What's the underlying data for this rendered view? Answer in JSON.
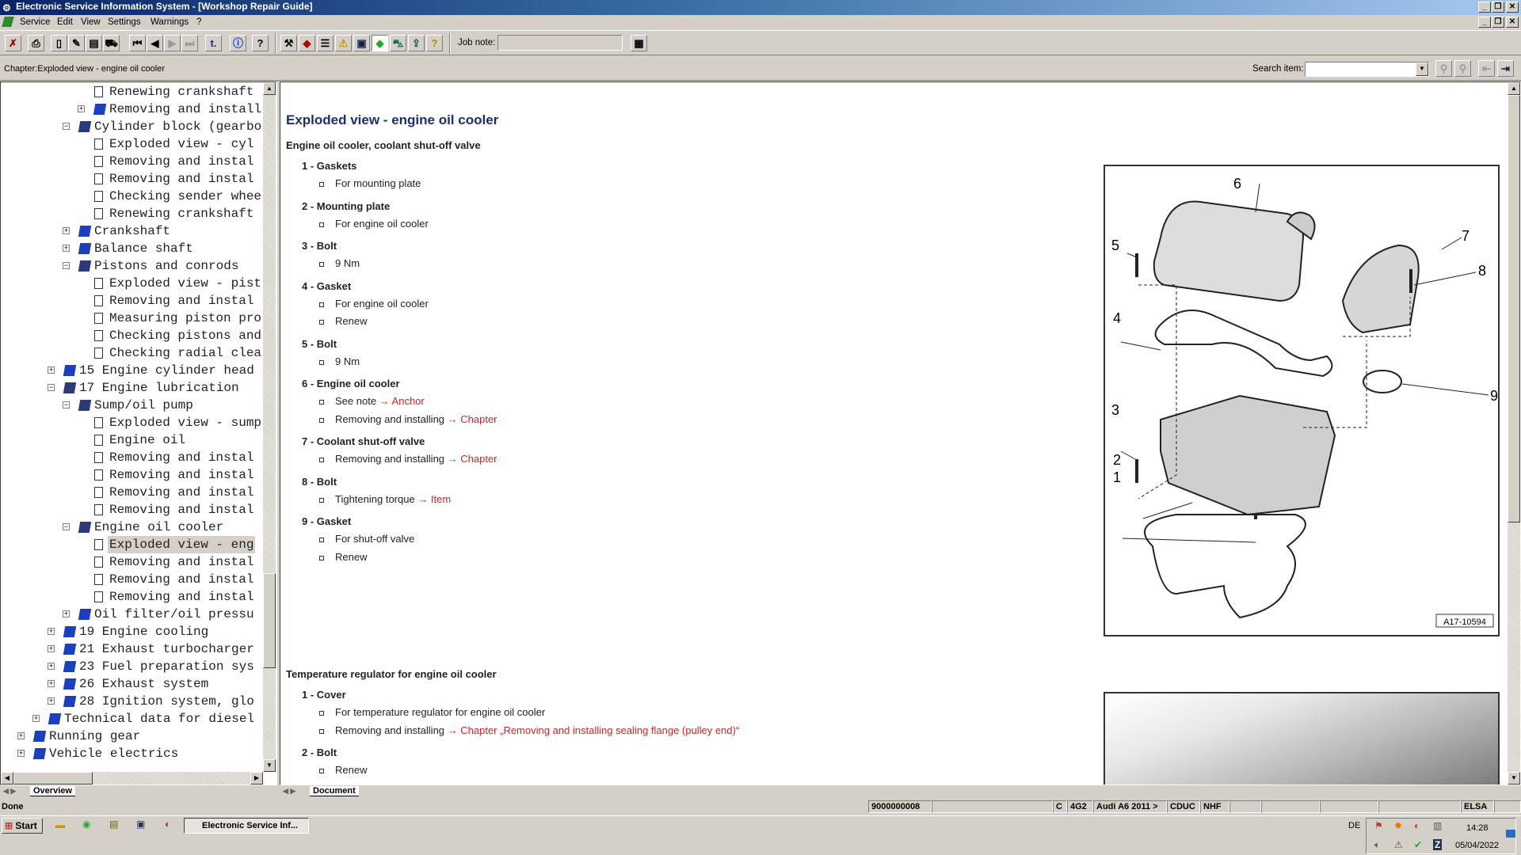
{
  "window": {
    "title": "Electronic Service Information System - [Workshop Repair Guide]"
  },
  "menu": [
    "Service",
    "Edit",
    "View",
    "Settings",
    "Warnings",
    "?"
  ],
  "toolbar": {
    "job_note_label": "Job note:",
    "job_note_value": "",
    "icons": [
      "close-app-icon",
      "print-icon",
      "new-document-icon",
      "edit-document-icon",
      "clipboard-icon",
      "vehicle-icon",
      "first-icon",
      "previous-icon",
      "next-icon",
      "last-icon",
      "back-icon",
      "info-icon",
      "help-icon",
      "tools-icon",
      "manual-icon",
      "list-icon",
      "warning-icon",
      "save-icon",
      "book-icon",
      "car-icon",
      "export-icon",
      "question-note-icon"
    ]
  },
  "chapter_bar": {
    "chapter": "Chapter:Exploded view - engine oil cooler",
    "search_label": "Search item:",
    "search_value": ""
  },
  "tree": [
    {
      "level": 5,
      "icon": "page",
      "exp": "",
      "label": "Renewing crankshaft"
    },
    {
      "level": 5,
      "icon": "book",
      "exp": "+",
      "label": "Removing and install"
    },
    {
      "level": 4,
      "icon": "open",
      "exp": "-",
      "label": "Cylinder block (gearbo"
    },
    {
      "level": 5,
      "icon": "page",
      "exp": "",
      "label": "Exploded view - cyl"
    },
    {
      "level": 5,
      "icon": "page",
      "exp": "",
      "label": "Removing and instal"
    },
    {
      "level": 5,
      "icon": "page",
      "exp": "",
      "label": "Removing and instal"
    },
    {
      "level": 5,
      "icon": "page",
      "exp": "",
      "label": "Checking sender whee"
    },
    {
      "level": 5,
      "icon": "page",
      "exp": "",
      "label": "Renewing crankshaft"
    },
    {
      "level": 4,
      "icon": "book",
      "exp": "+",
      "label": "Crankshaft"
    },
    {
      "level": 4,
      "icon": "book",
      "exp": "+",
      "label": "Balance shaft"
    },
    {
      "level": 4,
      "icon": "open",
      "exp": "-",
      "label": "Pistons and conrods"
    },
    {
      "level": 5,
      "icon": "page",
      "exp": "",
      "label": "Exploded view - pist"
    },
    {
      "level": 5,
      "icon": "page",
      "exp": "",
      "label": "Removing and instal"
    },
    {
      "level": 5,
      "icon": "page",
      "exp": "",
      "label": "Measuring piston pro"
    },
    {
      "level": 5,
      "icon": "page",
      "exp": "",
      "label": "Checking pistons and"
    },
    {
      "level": 5,
      "icon": "page",
      "exp": "",
      "label": "Checking radial clea"
    },
    {
      "level": 3,
      "icon": "book",
      "exp": "+",
      "label": "15 Engine cylinder head"
    },
    {
      "level": 3,
      "icon": "open",
      "exp": "-",
      "label": "17 Engine lubrication"
    },
    {
      "level": 4,
      "icon": "open",
      "exp": "-",
      "label": "Sump/oil pump"
    },
    {
      "level": 5,
      "icon": "page",
      "exp": "",
      "label": "Exploded view - sump"
    },
    {
      "level": 5,
      "icon": "page",
      "exp": "",
      "label": "Engine oil"
    },
    {
      "level": 5,
      "icon": "page",
      "exp": "",
      "label": "Removing and instal"
    },
    {
      "level": 5,
      "icon": "page",
      "exp": "",
      "label": "Removing and instal"
    },
    {
      "level": 5,
      "icon": "page",
      "exp": "",
      "label": "Removing and instal"
    },
    {
      "level": 5,
      "icon": "page",
      "exp": "",
      "label": "Removing and instal"
    },
    {
      "level": 4,
      "icon": "open",
      "exp": "-",
      "label": "Engine oil cooler"
    },
    {
      "level": 5,
      "icon": "page",
      "exp": "",
      "label": "Exploded view - eng",
      "selected": true
    },
    {
      "level": 5,
      "icon": "page",
      "exp": "",
      "label": "Removing and instal"
    },
    {
      "level": 5,
      "icon": "page",
      "exp": "",
      "label": "Removing and instal"
    },
    {
      "level": 5,
      "icon": "page",
      "exp": "",
      "label": "Removing and instal"
    },
    {
      "level": 4,
      "icon": "book",
      "exp": "+",
      "label": "Oil filter/oil pressu"
    },
    {
      "level": 3,
      "icon": "book",
      "exp": "+",
      "label": "19 Engine cooling"
    },
    {
      "level": 3,
      "icon": "book",
      "exp": "+",
      "label": "21 Exhaust turbocharger"
    },
    {
      "level": 3,
      "icon": "book",
      "exp": "+",
      "label": "23 Fuel preparation sys"
    },
    {
      "level": 3,
      "icon": "book",
      "exp": "+",
      "label": "26 Exhaust system"
    },
    {
      "level": 3,
      "icon": "book",
      "exp": "+",
      "label": "28 Ignition system, glo"
    },
    {
      "level": 2,
      "icon": "book",
      "exp": "+",
      "label": "Technical data for diesel"
    },
    {
      "level": 1,
      "icon": "book",
      "exp": "+",
      "label": "Running gear"
    },
    {
      "level": 1,
      "icon": "book",
      "exp": "+",
      "label": "Vehicle electrics"
    }
  ],
  "left_tab": "Overview",
  "right_tab": "Document",
  "document": {
    "title": "Exploded view - engine oil cooler",
    "section1": {
      "heading": "Engine oil cooler, coolant shut-off valve",
      "items": [
        {
          "head": "1 - Gaskets",
          "bullets": [
            {
              "text": "For mounting plate"
            }
          ]
        },
        {
          "head": "2 - Mounting plate",
          "bullets": [
            {
              "text": "For engine oil cooler"
            }
          ]
        },
        {
          "head": "3 - Bolt",
          "bullets": [
            {
              "text": "9 Nm"
            }
          ]
        },
        {
          "head": "4 - Gasket",
          "bullets": [
            {
              "text": "For engine oil cooler"
            },
            {
              "text": "Renew"
            }
          ]
        },
        {
          "head": "5 - Bolt",
          "bullets": [
            {
              "text": "9 Nm"
            }
          ]
        },
        {
          "head": "6 - Engine oil cooler",
          "bullets": [
            {
              "text": "See note ",
              "link": "→ Anchor"
            },
            {
              "text": "Removing and installing ",
              "link": "→ Chapter"
            }
          ]
        },
        {
          "head": "7 - Coolant shut-off valve",
          "bullets": [
            {
              "text": "Removing and installing ",
              "link": "→ Chapter"
            }
          ]
        },
        {
          "head": "8 - Bolt",
          "bullets": [
            {
              "text": "Tightening torque ",
              "link": "→ Item"
            }
          ]
        },
        {
          "head": "9 - Gasket",
          "bullets": [
            {
              "text": "For shut-off valve"
            },
            {
              "text": "Renew"
            }
          ]
        }
      ],
      "figure_labels": [
        "1",
        "2",
        "3",
        "4",
        "5",
        "6",
        "7",
        "8",
        "9"
      ],
      "figure_id": "A17-10594"
    },
    "section2": {
      "heading": "Temperature regulator for engine oil cooler",
      "items": [
        {
          "head": "1 - Cover",
          "bullets": [
            {
              "text": "For temperature regulator for engine oil cooler"
            },
            {
              "text": "Removing and installing ",
              "link": "→ Chapter „Removing and installing sealing flange (pulley end)“"
            }
          ]
        },
        {
          "head": "2 - Bolt",
          "bullets": [
            {
              "text": "Renew"
            }
          ]
        }
      ]
    }
  },
  "status": {
    "left": "Done",
    "cells": [
      "9000000008",
      "",
      "C",
      "4G2",
      "Audi A6 2011 >",
      "CDUC",
      "NHF",
      "",
      "",
      "",
      "",
      "ELSA",
      ""
    ]
  },
  "taskbar": {
    "start": "Start",
    "task": "Electronic Service Inf...",
    "lang": "DE",
    "time": "14:28",
    "date": "05/04/2022"
  },
  "colors": {
    "title_blue": "#1c2e6e",
    "link_red": "#c8282e",
    "titlebar": "#0a246a"
  }
}
